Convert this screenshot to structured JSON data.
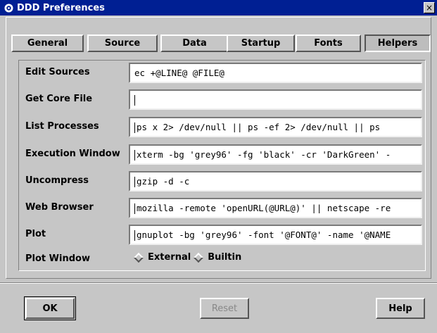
{
  "window": {
    "title": "DDD Preferences",
    "close_label": "×"
  },
  "tabs": [
    {
      "label": "General",
      "active": false
    },
    {
      "label": "Source",
      "active": false
    },
    {
      "label": "Data",
      "active": false
    },
    {
      "label": "Startup",
      "active": false
    },
    {
      "label": "Fonts",
      "active": false
    },
    {
      "label": "Helpers",
      "active": true
    }
  ],
  "helpers": {
    "rows": [
      {
        "label": "Edit Sources",
        "value": "ec +@LINE@ @FILE@"
      },
      {
        "label": "Get Core File",
        "value": ""
      },
      {
        "label": "List Processes",
        "value": "ps x 2> /dev/null || ps -ef 2> /dev/null || ps"
      },
      {
        "label": "Execution Window",
        "value": "xterm -bg 'grey96' -fg 'black' -cr 'DarkGreen' -"
      },
      {
        "label": "Uncompress",
        "value": "gzip -d -c"
      },
      {
        "label": "Web Browser",
        "value": "mozilla -remote 'openURL(@URL@)' || netscape -re"
      },
      {
        "label": "Plot",
        "value": "gnuplot -bg 'grey96' -font '@FONT@' -name '@NAME"
      }
    ],
    "plot_window": {
      "label": "Plot Window",
      "options": [
        "External",
        "Builtin"
      ]
    }
  },
  "buttons": {
    "ok": "OK",
    "reset": "Reset",
    "help": "Help"
  }
}
